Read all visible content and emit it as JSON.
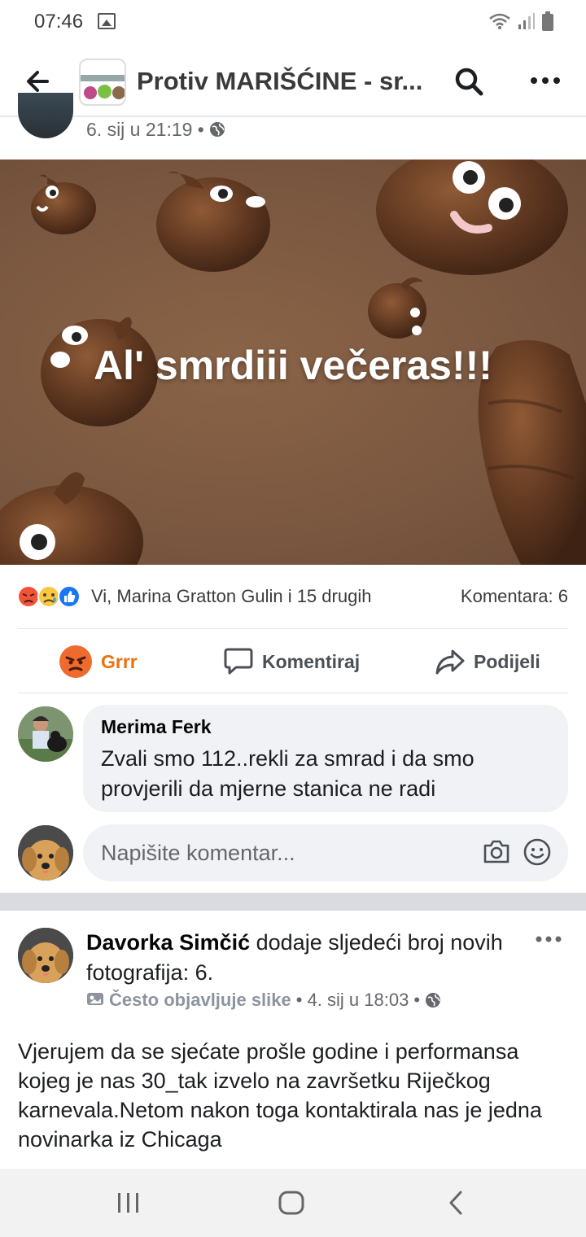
{
  "status_bar": {
    "time": "07:46"
  },
  "app_bar": {
    "title": "Protiv MARIŠĆINE - sr..."
  },
  "post1": {
    "time": "6. sij u 21:19 •",
    "image_caption": "Al' smrdiii večeras!!!",
    "reactions_text": "Vi, Marina Gratton Gulin i 15 drugih",
    "comments_count": "Komentara: 6",
    "actions": {
      "react_label": "Grrr",
      "comment_label": "Komentiraj",
      "share_label": "Podijeli"
    },
    "comment": {
      "author": "Merima Ferk",
      "text": "Zvali smo 112..rekli za smrad i da smo provjerili da mjerne stanica ne radi"
    },
    "write_comment": {
      "placeholder": "Napišite komentar..."
    }
  },
  "post2": {
    "author": "Davorka Simčić",
    "action_text": " dodaje sljedeći broj novih fotografija: 6.",
    "badge": "Često objavljuje slike",
    "time": "• 4. sij u 18:03 •",
    "body": "Vjerujem da se sjećate prošle godine i performansa kojeg je nas 30_tak izvelo na završetku Riječkog karnevala.Netom nakon toga kontaktirala nas je jedna novinarka iz Chicaga"
  },
  "colors": {
    "accent_orange": "#e9710f",
    "bubble_bg": "#f0f2f5",
    "text_secondary": "#65676b"
  }
}
